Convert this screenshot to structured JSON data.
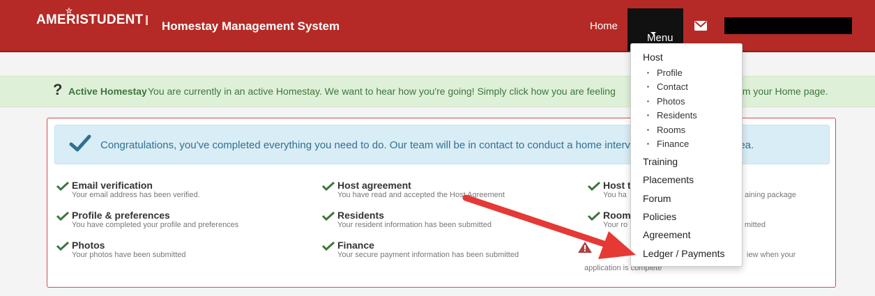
{
  "nav": {
    "logo": "AMERISTUDENT",
    "title": "Homestay Management System",
    "home": "Home",
    "menu": "Menu"
  },
  "alert": {
    "icon": "?",
    "bold": "Active Homestay",
    "text_left": "You are currently in an active Homestay. We want to hear how you're going! Simply click how you are feeling",
    "text_right": "om your Home page."
  },
  "info": {
    "text_left": "Congratulations, you've completed everything you need to do. Our team will be in contact to conduct a home interview v",
    "text_right": "area."
  },
  "steps": [
    {
      "title": "Email verification",
      "desc": "Your email address has been verified."
    },
    {
      "title": "Profile & preferences",
      "desc": "You have completed your profile and preferences"
    },
    {
      "title": "Photos",
      "desc": "Your photos have been submitted"
    },
    {
      "title": "Host agreement",
      "desc": "You have read and accepted the Host Agreement"
    },
    {
      "title": "Residents",
      "desc": "Your resident information has been submitted"
    },
    {
      "title": "Finance",
      "desc": "Your secure payment information has been submitted"
    },
    {
      "title": "Host t",
      "desc": "You ha"
    },
    {
      "title": "Room",
      "desc": "Your ro"
    }
  ],
  "partials": {
    "training_pkg": "aining package",
    "mitted": "mitted",
    "warn_right": "iew when your",
    "warn_bottom": "application is complete"
  },
  "menu": {
    "host": "Host",
    "host_items": [
      "Profile",
      "Contact",
      "Photos",
      "Residents",
      "Rooms",
      "Finance"
    ],
    "items": [
      "Training",
      "Placements",
      "Forum",
      "Policies",
      "Agreement",
      "Ledger / Payments"
    ]
  },
  "colors": {
    "brand": "#b52a26",
    "success": "#3c763d",
    "arrow": "#e53935"
  }
}
